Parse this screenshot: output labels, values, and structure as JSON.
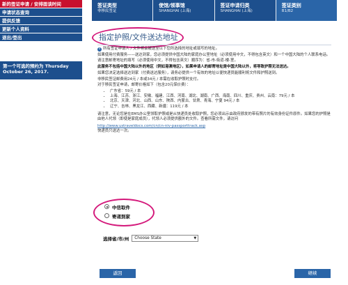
{
  "sidebar": {
    "items": [
      {
        "label": "新的签证申请 / 安排面谈时间",
        "active": true
      },
      {
        "label": "申请状态查询",
        "active": false
      },
      {
        "label": "提供反馈",
        "active": false
      },
      {
        "label": "更新个人资料",
        "active": false
      },
      {
        "label": "退出/登出",
        "active": false
      }
    ],
    "appointment_text": "第一个可选的预约为 Thursday October 26, 2017."
  },
  "steps": [
    {
      "title": "签证类型",
      "subtitle": "非移民签证"
    },
    {
      "title": "使馆/领事馆",
      "subtitle": "SHANGHAI (上海)"
    },
    {
      "title": "签证申请归类",
      "subtitle": "SHANGHAI (上海)"
    },
    {
      "title": "签证类别",
      "subtitle": "B1/B2"
    }
  ],
  "page_title": "指定护照/文件送达地址",
  "paragraphs": {
    "p1": "所有签证申请人 / 文件将会被送至以下您所选择的地址或填写的地址。",
    "p2": "如果使用付费服务——送达到家，您必须提供中国大陆的家庭办公室地址（必须使用中文，不得包含英文）和一个中国大陆的个人联系电话。",
    "p3": "请注意邮寄地址的填写（必须使用中文，不得包含英文）顺序为：省-市-街道-楼-室。",
    "p4": "此服务不包括中国大陆以外的地区（例如港澳地区），如果申请人的邮寄地址是中国大陆以外，将导致护照无法送达。",
    "p5": "如果您决定选择送达到家（付费送达服务），请务必提供一个有效的地址以便快递员能顺利将文件和护照送到。",
    "p6": "非移民签证邮费用24元 / 本或34元 / 本需在收取护照时支付。",
    "p7": "对于移民签证申请，邮寄价格如下（包含20元保价费）：",
    "p8": "请注意，无论您是在EMS办公室领取护照或是从快递员处收取护照，您必须出示由政府颁发的带有照片的有效身份证件原件。如果您的护照是由他人代领（即使是家庭成员），代领人必须提供额外的文件。查看所需文件，请访问",
    "link": "http://www.ustraveldocs.com/cn/cn-niv-passporttrack.asp",
    "p9": "快递员只送达一次。"
  },
  "prices": [
    "广东省：59元 / 本",
    "上海、江苏、浙江、安徽、福建、江西、河南、湖北、湖南、广西、海南、四川、重庆、贵州、云南：79元 / 本",
    "北京、天津、河北、山西、山东、陕西、内蒙古、甘肃、青海、宁夏 94元 / 本",
    "辽宁、吉林、黑龙江、西藏、新疆：119元 / 本"
  ],
  "delivery_options": [
    {
      "label": "中信取件",
      "checked": true
    },
    {
      "label": "寄递到家",
      "checked": false
    }
  ],
  "state_field": {
    "label": "选择省/市/州",
    "value": "Choose State"
  },
  "buttons": {
    "back": "返回",
    "next": "继续"
  },
  "colors": {
    "nav_blue": "#1d4f8d",
    "active_red": "#c8102e",
    "highlight_magenta": "#d4197b"
  }
}
